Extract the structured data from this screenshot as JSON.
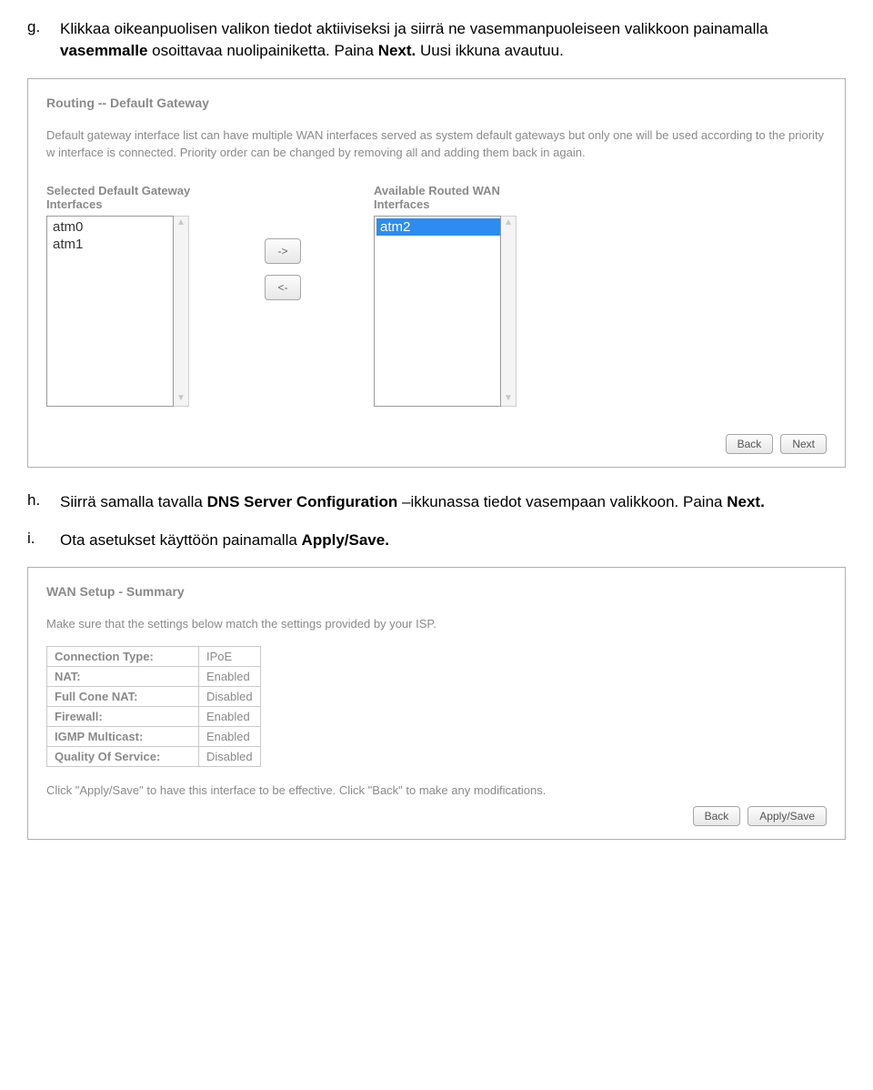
{
  "steps": {
    "g": {
      "letter": "g.",
      "text_a": "Klikkaa oikeanpuolisen valikon tiedot aktiiviseksi ja siirrä ne vasemmanpuoleiseen valikkoon painamalla ",
      "bold_b": "vasemmalle",
      "text_c": " osoittavaa nuolipainiketta. Paina ",
      "bold_d": "Next.",
      "text_e": " Uusi ikkuna avautuu."
    },
    "h": {
      "letter": "h.",
      "text_a": "Siirrä samalla tavalla ",
      "bold_b": "DNS Server Configuration",
      "text_c": " –ikkunassa tiedot vasempaan valikkoon. Paina ",
      "bold_d": "Next."
    },
    "i": {
      "letter": "i.",
      "text_a": "Ota asetukset käyttöön painamalla ",
      "bold_b": "Apply/Save."
    }
  },
  "routing": {
    "title": "Routing -- Default Gateway",
    "desc": "Default gateway interface list can have multiple WAN interfaces served as system default gateways but only one will be used according to the priority w interface is connected. Priority order can be changed by removing all and adding them back in again.",
    "left_head_a": "Selected Default Gateway",
    "left_head_b": "Interfaces",
    "right_head_a": "Available Routed WAN",
    "right_head_b": "Interfaces",
    "left_items": {
      "0": "atm0",
      "1": "atm1"
    },
    "right_items": {
      "0": "atm2"
    },
    "btn_right": "->",
    "btn_left": "<-",
    "back": "Back",
    "next": "Next"
  },
  "wan": {
    "title": "WAN Setup - Summary",
    "desc": "Make sure that the settings below match the settings provided by your ISP.",
    "rows": {
      "0": {
        "k": "Connection Type:",
        "v": "IPoE"
      },
      "1": {
        "k": "NAT:",
        "v": "Enabled"
      },
      "2": {
        "k": "Full Cone NAT:",
        "v": "Disabled"
      },
      "3": {
        "k": "Firewall:",
        "v": "Enabled"
      },
      "4": {
        "k": "IGMP Multicast:",
        "v": "Enabled"
      },
      "5": {
        "k": "Quality Of Service:",
        "v": "Disabled"
      }
    },
    "foot": "Click \"Apply/Save\" to have this interface to be effective. Click \"Back\" to make any modifications.",
    "back": "Back",
    "apply": "Apply/Save"
  }
}
